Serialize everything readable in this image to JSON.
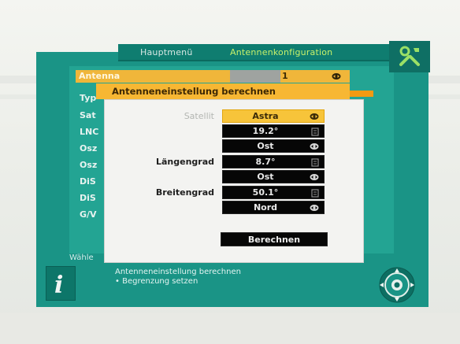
{
  "header": {
    "breadcrumb": "Hauptmenü",
    "title": "Antennenkonfiguration",
    "tool_icon": "tools-icon"
  },
  "menu": {
    "antenna_row": {
      "label": "Antenna",
      "value": "1"
    },
    "items": [
      "Typ",
      "Sat",
      "LNC",
      "Osz",
      "Osz",
      "DiS",
      "DiS",
      "G/V"
    ]
  },
  "dialog": {
    "title": "Antenneneinstellung berechnen",
    "fields": [
      {
        "label": "Satellit",
        "value": "Astra",
        "selected": true,
        "icon": "select-arrows-icon"
      },
      {
        "label": "",
        "value": "19.2°",
        "icon": "edit-icon"
      },
      {
        "label": "",
        "value": "Ost",
        "icon": "select-arrows-icon"
      },
      {
        "label": "Längengrad",
        "value": "8.7°",
        "icon": "edit-icon"
      },
      {
        "label": "",
        "value": "Ost",
        "icon": "select-arrows-icon"
      },
      {
        "label": "Breitengrad",
        "value": "50.1°",
        "icon": "edit-icon"
      },
      {
        "label": "",
        "value": "Nord",
        "icon": "select-arrows-icon"
      }
    ],
    "calculate_button": "Berechnen"
  },
  "footer": {
    "hint_prefix": "Wähle",
    "help_lines": [
      "Antenneneinstellung berechnen",
      "• Begrenzung setzen"
    ],
    "info_icon": "info-icon",
    "nav_icon": "navigation-pad-icon"
  },
  "colors": {
    "panel": "#1a9486",
    "highlight": "#f7b733",
    "field_bg": "#060606",
    "header_accent": "#c8f16a"
  }
}
